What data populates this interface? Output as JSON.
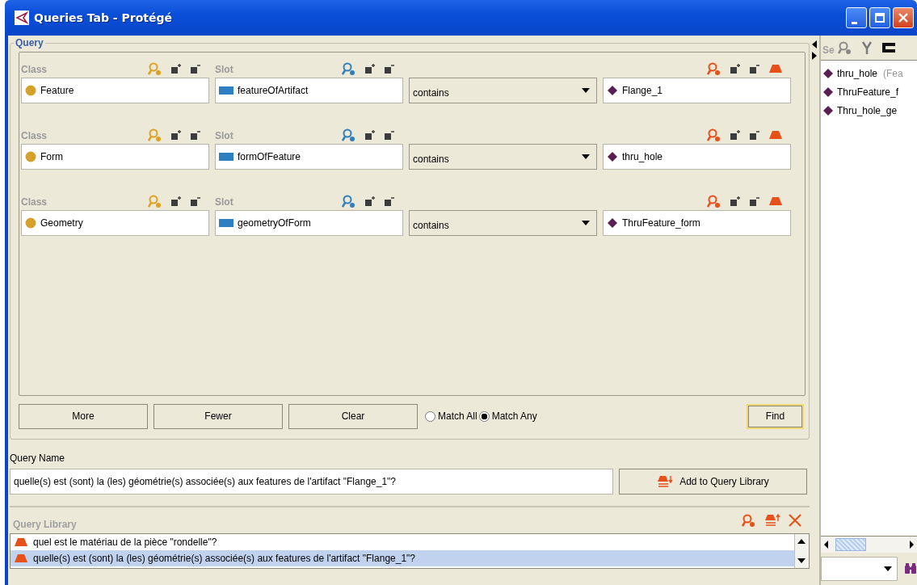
{
  "window": {
    "title": "Queries Tab - Protégé"
  },
  "query": {
    "title": "Query",
    "rows": [
      {
        "class_label": "Class",
        "class": "Feature",
        "slot_label": "Slot",
        "slot": "featureOfArtifact",
        "operator": "contains",
        "value": "Flange_1"
      },
      {
        "class_label": "Class",
        "class": "Form",
        "slot_label": "Slot",
        "slot": "formOfFeature",
        "operator": "contains",
        "value": "thru_hole"
      },
      {
        "class_label": "Class",
        "class": "Geometry",
        "slot_label": "Slot",
        "slot": "geometryOfForm",
        "operator": "contains",
        "value": "ThruFeature_form"
      }
    ],
    "buttons": [
      "More",
      "Fewer",
      "Clear"
    ],
    "match": [
      {
        "label": "Match All",
        "selected": false
      },
      {
        "label": "Match Any",
        "selected": true
      }
    ],
    "find_button": "Find"
  },
  "query_name": {
    "label": "Query Name",
    "value": "quelle(s) est (sont) la (les) géométrie(s) associée(s) aux features de l'artifact \"Flange_1\"?",
    "add_button": "Add to Query Library"
  },
  "query_library": {
    "title": "Query Library",
    "items": [
      {
        "text": "quel est le matériau de la pièce \"rondelle\"?",
        "selected": false
      },
      {
        "text": "quelle(s) est (sont) la (les) géométrie(s) associée(s) aux features de l'artifact \"Flange_1\"?",
        "selected": true
      }
    ]
  },
  "side_panel": {
    "label": "Se",
    "items": [
      {
        "name": "thru_hole",
        "type": "(Fea"
      },
      {
        "name": "ThruFeature_f"
      },
      {
        "name": "Thru_hole_ge"
      }
    ]
  }
}
